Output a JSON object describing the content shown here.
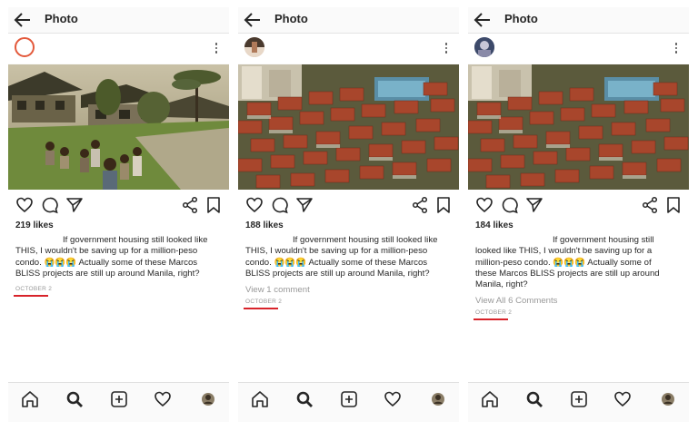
{
  "panels": [
    {
      "title": "Photo",
      "likes": "219 likes",
      "caption": "If government housing still looked like THIS, I wouldn't be saving up for a million-peso condo. 😭😭😭 Actually some of these Marcos BLISS projects are still up around Manila, right?",
      "comments": "",
      "date": "OCTOBER 2"
    },
    {
      "title": "Photo",
      "likes": "188 likes",
      "caption": "If government housing still looked like THIS, I wouldn't be saving up for a million-peso condo. 😭😭😭 Actually some of these Marcos BLISS projects are still up around Manila, right?",
      "comments": "View 1 comment",
      "date": "OCTOBER 2"
    },
    {
      "title": "Photo",
      "likes": "184 likes",
      "caption": "If government housing still looked like THIS, I wouldn't be saving up for a million-peso condo. 😭😭😭 Actually some of these Marcos BLISS projects are still up around Manila, right?",
      "comments": "View All 6 Comments",
      "date": "OCTOBER 2"
    }
  ],
  "icons": {
    "back": "back-arrow-icon",
    "menu": "more-options-icon",
    "like": "heart-icon",
    "comment": "comment-icon",
    "share": "send-icon",
    "share2": "share-icon",
    "save": "bookmark-icon",
    "nav": [
      "home-icon",
      "search-icon",
      "add-post-icon",
      "activity-heart-icon",
      "profile-icon"
    ]
  },
  "colors": {
    "underline": "#d8232a",
    "emoji": "#f0b73d"
  }
}
